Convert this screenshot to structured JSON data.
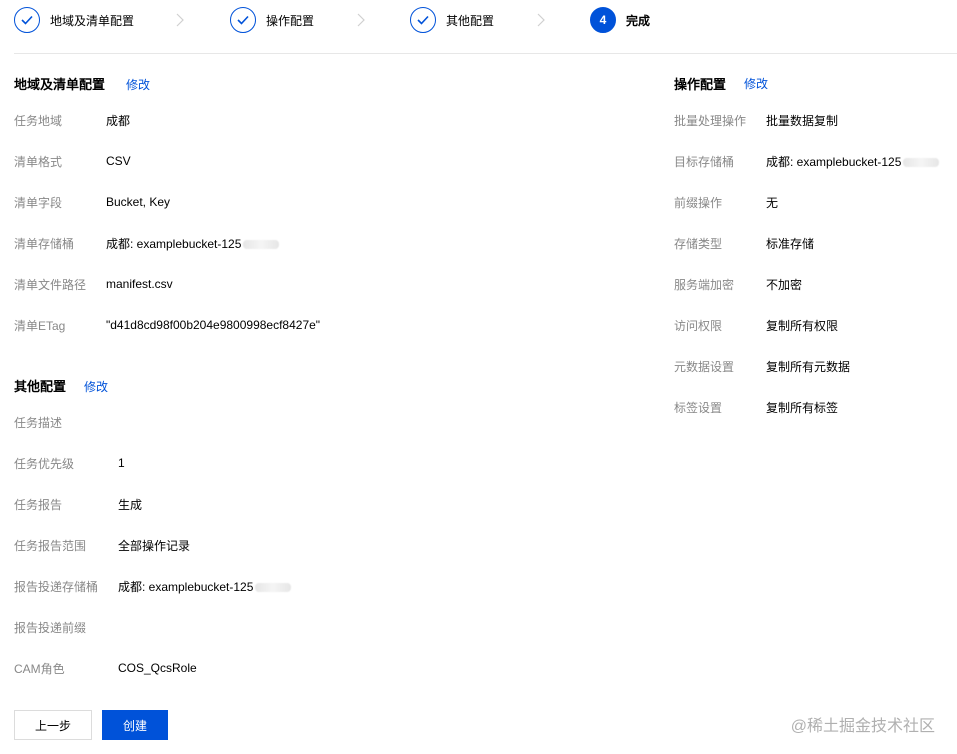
{
  "steps": [
    {
      "label": "地域及清单配置",
      "state": "done"
    },
    {
      "label": "操作配置",
      "state": "done"
    },
    {
      "label": "其他配置",
      "state": "done"
    },
    {
      "label": "完成",
      "state": "active",
      "number": "4"
    }
  ],
  "left_section1": {
    "title": "地域及清单配置",
    "edit": "修改",
    "rows": [
      {
        "k": "任务地域",
        "v": "成都"
      },
      {
        "k": "清单格式",
        "v": "CSV"
      },
      {
        "k": "清单字段",
        "v": "Bucket, Key"
      },
      {
        "k": "清单存储桶",
        "v": "成都: examplebucket-125"
      },
      {
        "k": "清单文件路径",
        "v": "manifest.csv"
      },
      {
        "k": "清单ETag",
        "v": "\"d41d8cd98f00b204e9800998ecf8427e\""
      }
    ]
  },
  "left_section2": {
    "title": "其他配置",
    "edit": "修改",
    "rows": [
      {
        "k": "任务描述",
        "v": ""
      },
      {
        "k": "任务优先级",
        "v": "1"
      },
      {
        "k": "任务报告",
        "v": "生成"
      },
      {
        "k": "任务报告范围",
        "v": "全部操作记录"
      },
      {
        "k": "报告投递存储桶",
        "v": "成都: examplebucket-125"
      },
      {
        "k": "报告投递前缀",
        "v": ""
      },
      {
        "k": "CAM角色",
        "v": "COS_QcsRole"
      }
    ]
  },
  "right_section": {
    "title": "操作配置",
    "edit": "修改",
    "rows": [
      {
        "k": "批量处理操作",
        "v": "批量数据复制"
      },
      {
        "k": "目标存储桶",
        "v": "成都: examplebucket-125"
      },
      {
        "k": "前缀操作",
        "v": "无"
      },
      {
        "k": "存储类型",
        "v": "标准存储"
      },
      {
        "k": "服务端加密",
        "v": "不加密"
      },
      {
        "k": "访问权限",
        "v": "复制所有权限"
      },
      {
        "k": "元数据设置",
        "v": "复制所有元数据"
      },
      {
        "k": "标签设置",
        "v": "复制所有标签"
      }
    ]
  },
  "buttons": {
    "prev": "上一步",
    "create": "创建"
  },
  "watermark": "@稀土掘金技术社区",
  "colors": {
    "accent": "#0052d9",
    "label": "#888888",
    "divider": "#e7e7e7"
  }
}
